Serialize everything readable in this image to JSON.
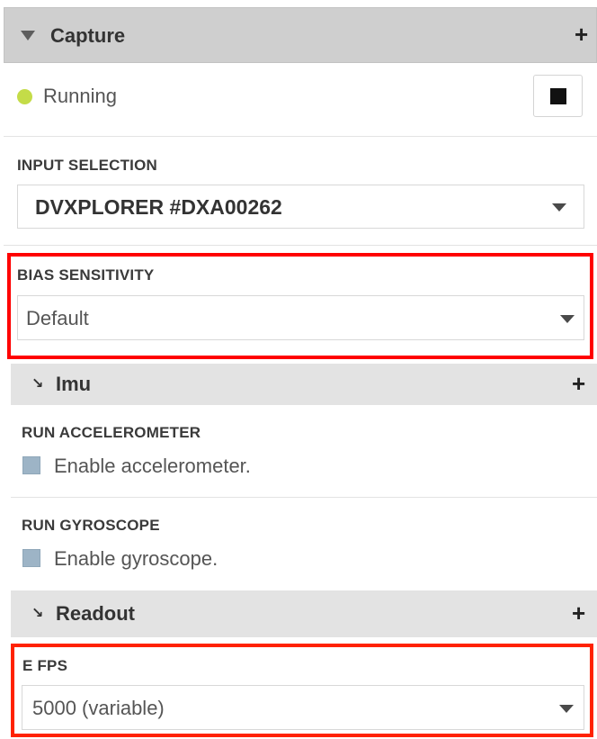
{
  "capture": {
    "title": "Capture",
    "add_icon": "plus-icon",
    "collapse_icon": "triangle-down-icon"
  },
  "status": {
    "text": "Running",
    "dot_color": "#c4dc48",
    "stop_icon": "stop-icon"
  },
  "input_selection": {
    "label": "INPUT SELECTION",
    "value": "DVXPLORER #DXA00262"
  },
  "bias_sensitivity": {
    "label": "BIAS SENSITIVITY",
    "value": "Default",
    "highlight_color": "#ff0000"
  },
  "imu": {
    "title": "Imu",
    "arrow_glyph": "↘",
    "run_accelerometer": {
      "label": "RUN ACCELEROMETER",
      "checkbox_text": "Enable accelerometer.",
      "checked": false
    },
    "run_gyroscope": {
      "label": "RUN GYROSCOPE",
      "checkbox_text": "Enable gyroscope.",
      "checked": false
    }
  },
  "readout": {
    "title": "Readout",
    "arrow_glyph": "↘",
    "e_fps": {
      "label": "E FPS",
      "value": "5000 (variable)",
      "highlight_color": "#ff2200"
    }
  },
  "plus_glyph": "+"
}
